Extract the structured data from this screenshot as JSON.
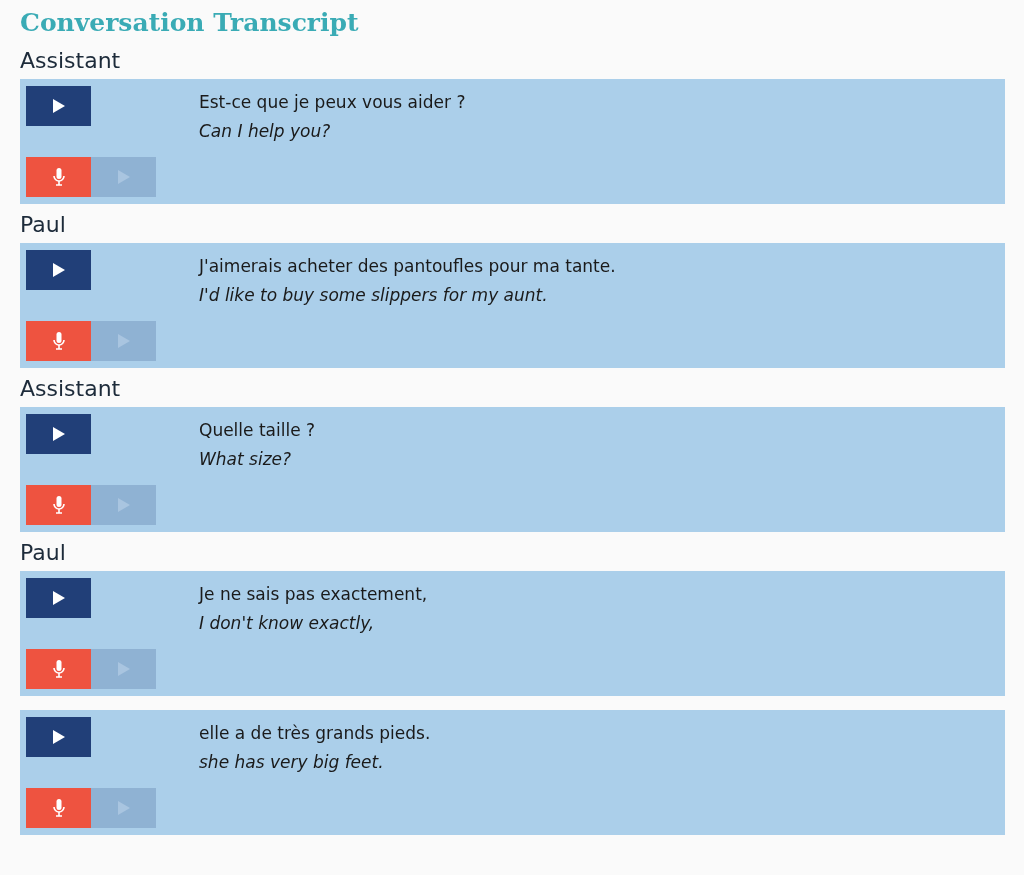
{
  "title": "Conversation Transcript",
  "lines": [
    {
      "speaker": "Assistant",
      "french": "Est-ce que je peux vous aider ?",
      "english": "Can I help you?",
      "playback_disabled": true
    },
    {
      "speaker": "Paul",
      "french": "J'aimerais acheter des pantoufles pour ma tante.",
      "english": "I'd like to buy some slippers for my aunt.",
      "playback_disabled": true
    },
    {
      "speaker": "Assistant",
      "french": "Quelle taille ?",
      "english": "What size?",
      "playback_disabled": true
    },
    {
      "speaker": "Paul",
      "french": "Je ne sais pas exactement,",
      "english": "I don't know exactly,",
      "playback_disabled": true
    },
    {
      "french": "elle a de très grands pieds.",
      "english": "she has very big feet.",
      "playback_disabled": true
    }
  ]
}
